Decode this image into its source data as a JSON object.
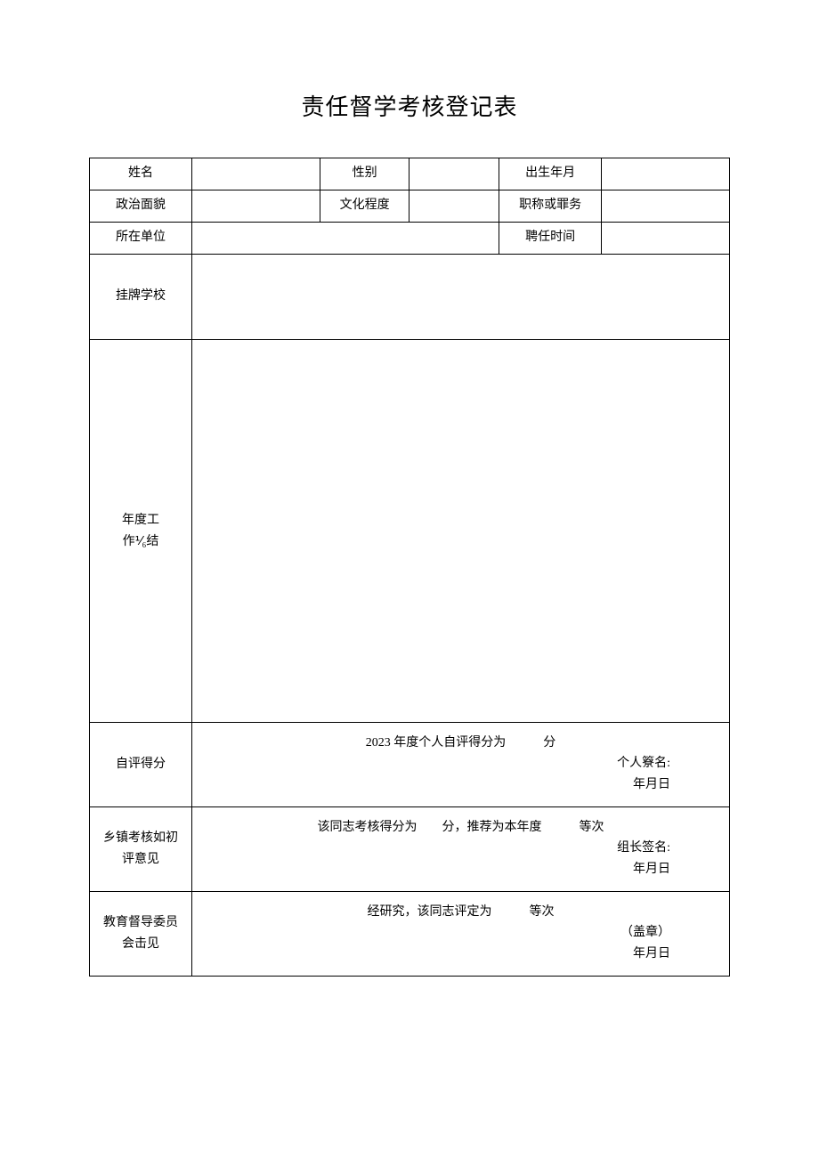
{
  "title": "责任督学考核登记表",
  "labels": {
    "name": "姓名",
    "gender": "性别",
    "birth": "出生年月",
    "political": "政治面貌",
    "education": "文化程度",
    "titleOrPost": "职称或罪务",
    "unit": "所在单位",
    "appointTime": "聘任时间",
    "school": "挂牌学校",
    "summary_l1": "年度工",
    "summary_l2": "作⅟₆结",
    "selfScore": "自评得分",
    "roadOpinion_l1": "乡镇考核如初",
    "roadOpinion_l2": "评意见",
    "committee_l1": "教育督导委员",
    "committee_l2": "会击见"
  },
  "selfScoreContent": {
    "line1": "2023 年度个人自评得分为　　　分",
    "sig": "个人簝名:",
    "date": "年月日"
  },
  "roadOpinionContent": {
    "line1": "该同志考核得分为　　分，推荐为本年度　　　等次",
    "sig": "组长签名:",
    "date": "年月日"
  },
  "committeeContent": {
    "line1": "经研究，该同志评定为　　　等次",
    "seal": "（盖章）",
    "date": "年月日"
  }
}
